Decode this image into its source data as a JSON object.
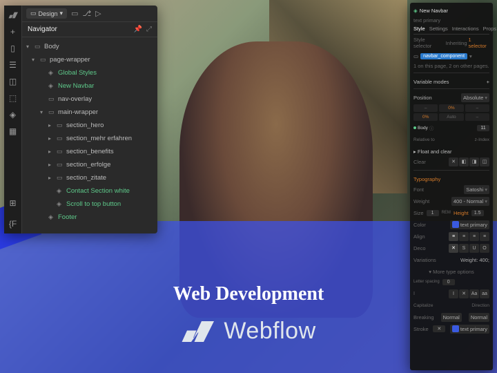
{
  "hero": {
    "title": "Web Development",
    "brand": "Webflow"
  },
  "navigator": {
    "mode_label": "Design",
    "panel_title": "Navigator",
    "tree": [
      {
        "label": "Body",
        "depth": 0,
        "chev": "open",
        "style": ""
      },
      {
        "label": "page-wrapper",
        "depth": 1,
        "chev": "open",
        "style": ""
      },
      {
        "label": "Global Styles",
        "depth": 2,
        "chev": "",
        "style": "green"
      },
      {
        "label": "New Navbar",
        "depth": 2,
        "chev": "",
        "style": "green"
      },
      {
        "label": "nav-overlay",
        "depth": 2,
        "chev": "",
        "style": ""
      },
      {
        "label": "main-wrapper",
        "depth": 2,
        "chev": "open",
        "style": ""
      },
      {
        "label": "section_hero",
        "depth": 3,
        "chev": "closed",
        "style": ""
      },
      {
        "label": "section_mehr erfahren",
        "depth": 3,
        "chev": "closed",
        "style": ""
      },
      {
        "label": "section_benefits",
        "depth": 3,
        "chev": "closed",
        "style": ""
      },
      {
        "label": "section_erfolge",
        "depth": 3,
        "chev": "closed",
        "style": ""
      },
      {
        "label": "section_zitate",
        "depth": 3,
        "chev": "closed",
        "style": ""
      },
      {
        "label": "Contact Section white",
        "depth": 3,
        "chev": "",
        "style": "green"
      },
      {
        "label": "Scroll to top button",
        "depth": 3,
        "chev": "",
        "style": "green"
      },
      {
        "label": "Footer",
        "depth": 2,
        "chev": "",
        "style": "green"
      }
    ]
  },
  "style_panel": {
    "element_label": "New Navbar",
    "element_sub": "text primary",
    "tabs": [
      "Style",
      "Settings",
      "Interactions",
      "Props"
    ],
    "selector_label": "Style selector",
    "inheriting": "Inheriting",
    "inheriting_count": "1 selector",
    "chip": "navbar_component",
    "instance_note": "1 on this page, 2 on other pages.",
    "variable_section": "Variable modes",
    "position": {
      "label": "Position",
      "value": "Absolute",
      "top": "0%",
      "auto": "Auto",
      "relative_to": "Body",
      "zindex": "11",
      "rel_label": "Relative to",
      "z_label": "z-Index",
      "float_label": "Float and clear",
      "clear_label": "Clear"
    },
    "typo": {
      "section": "Typography",
      "font_label": "Font",
      "font": "Satoshi",
      "weight_label": "Weight",
      "weight": "400 - Normal",
      "size_label": "Size",
      "size": "1",
      "size_unit": "REM",
      "height_label": "Height",
      "height": "1.5",
      "color_label": "Color",
      "color": "text primary",
      "align_label": "Align",
      "deco_label": "Deco",
      "variations_label": "Variations",
      "variations_val": "Weight: 400;",
      "more": "More type options",
      "breaking_label": "Breaking",
      "breaking": "Normal",
      "wrap": "Normal",
      "dir_label": "Direction",
      "ls_label": "Letter spacing",
      "ls_val": "0",
      "cap_label": "Capitalize",
      "italic_label": "Italicize",
      "stroke_row_label": "Stroke",
      "stroke_color": "text primary"
    }
  }
}
